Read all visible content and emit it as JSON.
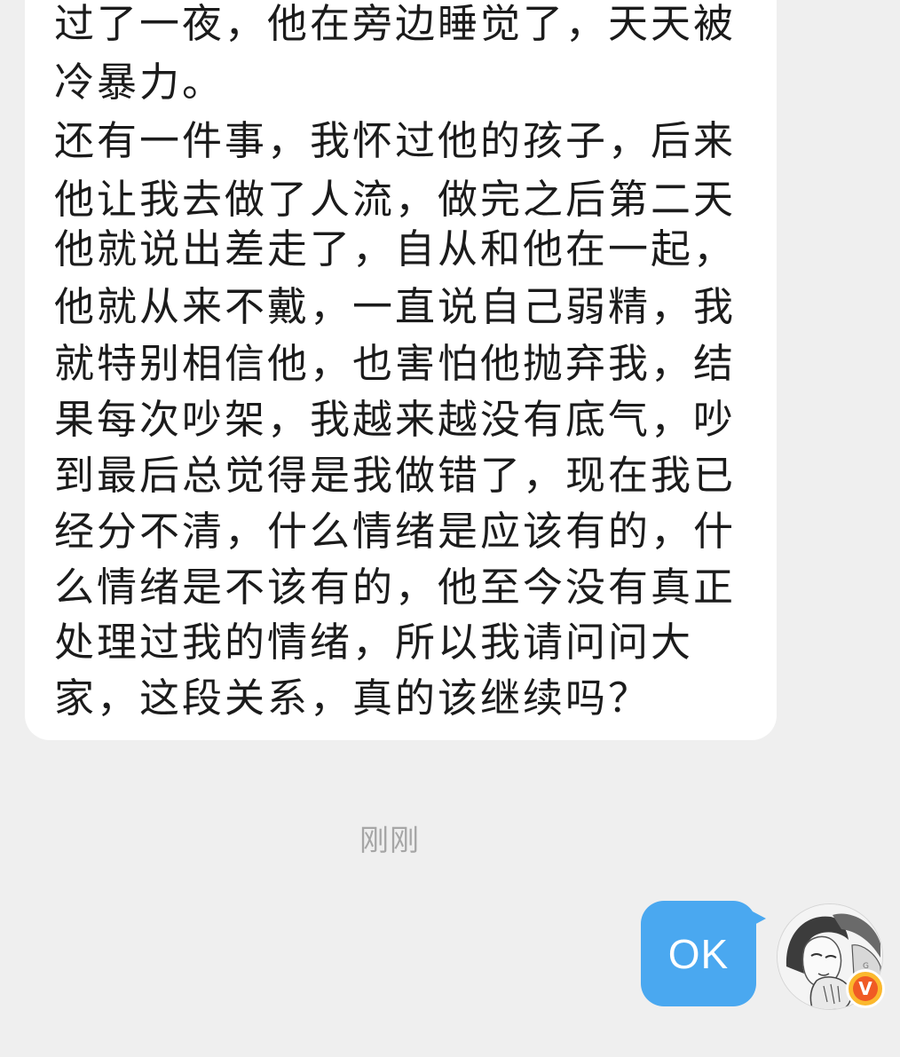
{
  "incoming_message": {
    "lines": [
      "过了一夜，他在旁边睡觉了，天天被",
      "冷暴力。",
      "还有一件事，我怀过他的孩子，后来",
      "他让我去做了人流，做完之后第二天",
      "他就说出差走了，自从和他在一起，",
      "他就从来不戴，一直说自己弱精，我",
      "就特别相信他，也害怕他抛弃我，结",
      "果每次吵架，我越来越没有底气，吵",
      "到最后总觉得是我做错了，现在我已",
      "经分不清，什么情绪是应该有的，什",
      "么情绪是不该有的，他至今没有真正",
      "处理过我的情绪，所以我请问问大",
      "家，这段关系，真的该继续吗？"
    ]
  },
  "timestamp": "刚刚",
  "outgoing_message": {
    "text": "OK"
  },
  "avatar": {
    "icon": "illustrated-portrait-avatar",
    "badge_icon": "verified-v-badge-icon",
    "badge_text": "V"
  },
  "colors": {
    "background": "#efefef",
    "incoming_bubble": "#ffffff",
    "outgoing_bubble": "#4aa8f0",
    "text": "#1b1b1b",
    "timestamp": "#a6a6a6",
    "badge_outer": "#fbb82d",
    "badge_inner": "#f05a24"
  }
}
